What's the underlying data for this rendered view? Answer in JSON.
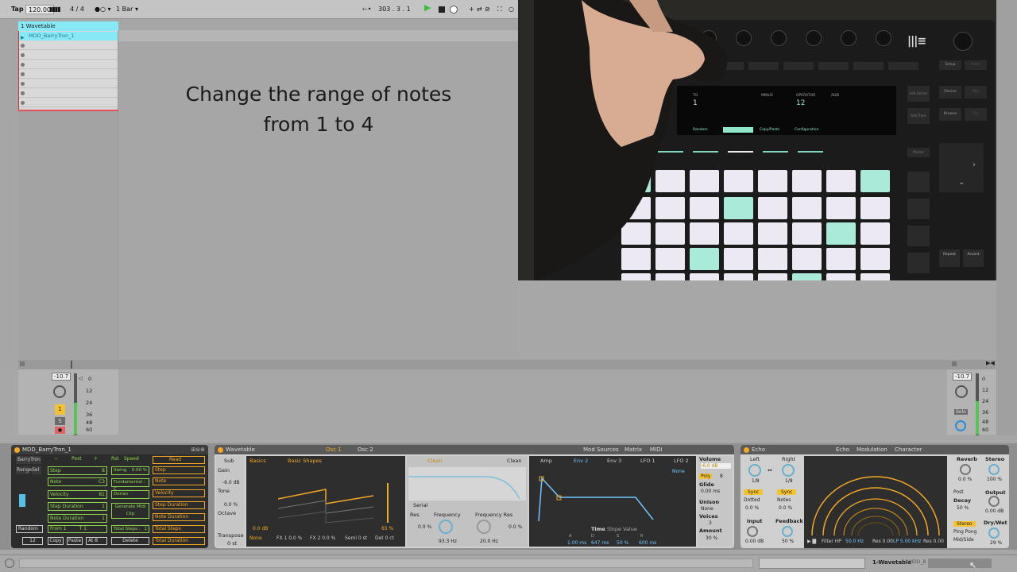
{
  "transport": {
    "tap": "Tap",
    "tempo": "120.00",
    "signature": "4 / 4",
    "quantize": "1 Bar",
    "position": "303 .  3 .  1"
  },
  "track": {
    "name": "1 Wavetable",
    "clip_name": "MDD_BarryTron_1"
  },
  "instruction": {
    "line1": "Change the range of notes",
    "line2": "from 1 to 4"
  },
  "push_display": {
    "to_label": "TO",
    "to_value": "1",
    "minus": "MINUS",
    "operator_label": "OPERATOR",
    "operator_value": "12",
    "add": "ADD",
    "menu": [
      "Random",
      "",
      "Copy/Paste",
      "Configuration"
    ],
    "left_buttons": [
      "Tap Tempo",
      "Delete",
      "Undo"
    ],
    "right_buttons": [
      "Setup",
      "User",
      "Device",
      "Mix",
      "Browse",
      "Clip",
      "Repeat",
      "Accent",
      "Add Device",
      "Add Track",
      "Master"
    ]
  },
  "mixer": {
    "volume": "-10.7",
    "scale": [
      "0",
      "12",
      "24",
      "36",
      "48",
      "60"
    ],
    "track_num": "1",
    "solo": "S"
  },
  "mixer_right": {
    "volume": "-10.7",
    "solo": "Solo"
  },
  "mdd": {
    "title": "MDD_BarryTron_1",
    "tabs": [
      "BarryTron",
      "Range",
      "Sel"
    ],
    "params": [
      {
        "name": "Step",
        "value": "8"
      },
      {
        "name": "Note",
        "value": "C3"
      },
      {
        "name": "Velocity",
        "value": "81"
      },
      {
        "name": "Step Duration",
        "value": "1"
      },
      {
        "name": "Note Duration",
        "value": "1"
      }
    ],
    "post": "Post",
    "swing_label": "Swing",
    "swing_value": "0.00 %",
    "rst": "Rst",
    "speed": "Speed",
    "read": "Read",
    "fundamental": "Fundamental : C",
    "scale": "Dorian",
    "generate": "Generate Midi Clip",
    "right_list": [
      "Step",
      "Note",
      "Velocity",
      "Step Duration",
      "Note Duration",
      "Total Steps",
      "Total Duration"
    ],
    "from_label": "From",
    "from_value": "1",
    "to_label": "T",
    "to_value": "1",
    "total_steps_label": "Total Steps :",
    "total_steps_value": "1",
    "random": "Random",
    "copy": "Copy",
    "paste": "Paste",
    "at": "At",
    "at_value": "8",
    "delete": "Delete",
    "num": "12"
  },
  "wavetable": {
    "title": "Wavetable",
    "osc1": "Osc 1",
    "osc2": "Osc 2",
    "sub": "Sub",
    "gain": "Gain",
    "gain_value": "-6.0 dB",
    "tone": "Tone",
    "tone_value": "0.0 %",
    "octave": "Octave",
    "transpose": "Transpose",
    "transpose_value": "0 st",
    "basics": "Basics",
    "basic_shapes": "Basic Shapes",
    "db": "0.0 dB",
    "pct": "65 %",
    "none": "None",
    "fx1": "FX 1  0.0 %",
    "fx2": "FX 2  0.0 %",
    "semi": "Semi  0 st",
    "det": "Det  0 ct",
    "filter_type": "Clean",
    "filter_type2": "Clean",
    "serial": "Serial",
    "res": "Res",
    "res_value": "0.0 %",
    "frequency": "Frequency",
    "frequency_value": "93.3 Hz",
    "freq_res": "Frequency Res",
    "freq_res_value": "20.0 Hz",
    "freq_res_pct": "0.0 %",
    "mod_sources": "Mod Sources",
    "matrix": "Matrix",
    "midi": "MIDI",
    "env_tabs": [
      "Amp",
      "Env 2",
      "Env 3",
      "LFO 1",
      "LFO 2"
    ],
    "env_none": "None",
    "time": "Time",
    "slope": "Slope",
    "value": "Value",
    "adsr_labels": [
      "A",
      "D",
      "S",
      "R"
    ],
    "adsr": [
      "1.00 ms",
      "647 ms",
      "50 %",
      "600 ms"
    ],
    "volume": "Volume",
    "volume_value": "-6.0 dB",
    "poly": "Poly",
    "poly_value": "8",
    "glide": "Glide",
    "glide_value": "0.00 ms",
    "unison": "Unison",
    "unison_value": "None",
    "voices": "Voices",
    "voices_value": "3",
    "amount": "Amount",
    "amount_value": "30 %"
  },
  "echo": {
    "title": "Echo",
    "tabs": [
      "Echo",
      "Modulation",
      "Character"
    ],
    "left": "Left",
    "left_value": "1/8",
    "right": "Right",
    "right_value": "1/8",
    "sync": "Sync",
    "dotted": "Dotted",
    "notes": "Notes",
    "pct_left": "0.0 %",
    "pct_right": "0.0 %",
    "input": "Input",
    "input_value": "0.00 dB",
    "feedback": "Feedback",
    "feedback_value": "50 %",
    "filter": "Filter HP",
    "filter_value": "50.0 Hz",
    "res1": "Res 0.00",
    "lp": "LP 5.00 kHz",
    "res2": "Res 0.00",
    "reverb": "Reverb",
    "reverb_value": "0.0 %",
    "stereo": "Stereo",
    "stereo_value": "100 %",
    "post": "Post",
    "decay": "Decay",
    "decay_value": "50 %",
    "output": "Output",
    "output_value": "0.00 dB",
    "stereo_mode": "Stereo",
    "ping_pong": "Ping Pong",
    "mid_side": "Mid/Side",
    "dry_wet": "Dry/Wet",
    "dry_wet_value": "29 %"
  },
  "status": {
    "track_label": "1-Wavetable",
    "device_label": "MDD_B"
  }
}
